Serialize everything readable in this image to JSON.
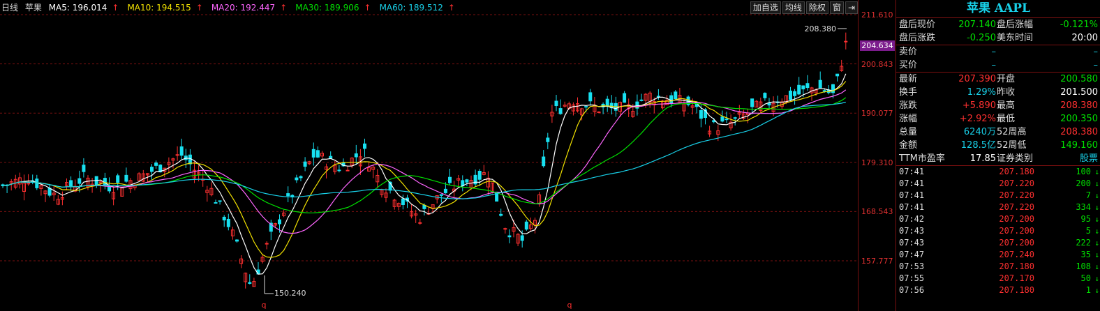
{
  "ma_bar": {
    "period": "日线",
    "stock": "苹果",
    "ma": [
      {
        "label": "MA5: 196.014",
        "color": "#ffffff"
      },
      {
        "label": "MA10: 194.515",
        "color": "#f0e000"
      },
      {
        "label": "MA20: 192.447",
        "color": "#ff66ff"
      },
      {
        "label": "MA30: 189.906",
        "color": "#00e000"
      },
      {
        "label": "MA60: 189.512",
        "color": "#18d0e8"
      }
    ],
    "up_arrow": "↑"
  },
  "toolbar": {
    "add_watch": "加自选",
    "ma_line": "均线",
    "adjust": "除权",
    "window": "窗",
    "exit": "⇥"
  },
  "price_axis": {
    "labels": [
      "211.610",
      "200.843",
      "190.077",
      "179.310",
      "168.543",
      "157.777"
    ],
    "current": "204.634"
  },
  "annotations": {
    "high": "208.380",
    "low": "150.240",
    "marker": "q"
  },
  "panel": {
    "title": "苹果 AAPL",
    "rows_top": [
      {
        "l": "盘后现价",
        "v": "207.140",
        "vc": "c-green",
        "l2": "盘后涨幅",
        "v2": "-0.121%",
        "v2c": "c-green"
      },
      {
        "l": "盘后涨跌",
        "v": "-0.250",
        "vc": "c-green",
        "l2": "美东时间",
        "v2": "20:00",
        "v2c": "c-white"
      }
    ],
    "rows_bidask": [
      {
        "l": "卖价",
        "v": "–",
        "v2": "–"
      },
      {
        "l": "买价",
        "v": "–",
        "v2": "–"
      }
    ],
    "rows_quote": [
      {
        "l": "最新",
        "v": "207.390",
        "vc": "c-red",
        "l2": "开盘",
        "v2": "200.580",
        "v2c": "c-green"
      },
      {
        "l": "换手",
        "v": "1.29%",
        "vc": "c-cyan",
        "l2": "昨收",
        "v2": "201.500",
        "v2c": "c-white"
      },
      {
        "l": "涨跌",
        "v": "+5.890",
        "vc": "c-red",
        "l2": "最高",
        "v2": "208.380",
        "v2c": "c-red"
      },
      {
        "l": "涨幅",
        "v": "+2.92%",
        "vc": "c-red",
        "l2": "最低",
        "v2": "200.350",
        "v2c": "c-green"
      },
      {
        "l": "总量",
        "v": "6240万",
        "vc": "c-cyan",
        "l2": "52周高",
        "v2": "208.380",
        "v2c": "c-red"
      },
      {
        "l": "金额",
        "v": "128.5亿",
        "vc": "c-cyan",
        "l2": "52周低",
        "v2": "149.160",
        "v2c": "c-green"
      },
      {
        "l": "TTM市盈率",
        "v": "17.85",
        "vc": "c-white",
        "l2": "证券类别",
        "v2": "股票",
        "v2c": "c-cyan"
      }
    ],
    "ticks": [
      {
        "time": "07:41",
        "price": "207.180",
        "vol": "100"
      },
      {
        "time": "07:41",
        "price": "207.220",
        "vol": "200"
      },
      {
        "time": "07:41",
        "price": "207.220",
        "vol": "7"
      },
      {
        "time": "07:41",
        "price": "207.220",
        "vol": "334"
      },
      {
        "time": "07:42",
        "price": "207.200",
        "vol": "95"
      },
      {
        "time": "07:43",
        "price": "207.200",
        "vol": "5"
      },
      {
        "time": "07:43",
        "price": "207.200",
        "vol": "222"
      },
      {
        "time": "07:47",
        "price": "207.240",
        "vol": "35"
      },
      {
        "time": "07:53",
        "price": "207.180",
        "vol": "108"
      },
      {
        "time": "07:55",
        "price": "207.170",
        "vol": "50"
      },
      {
        "time": "07:56",
        "price": "207.180",
        "vol": "1"
      }
    ],
    "tick_arrow": "↓"
  }
}
